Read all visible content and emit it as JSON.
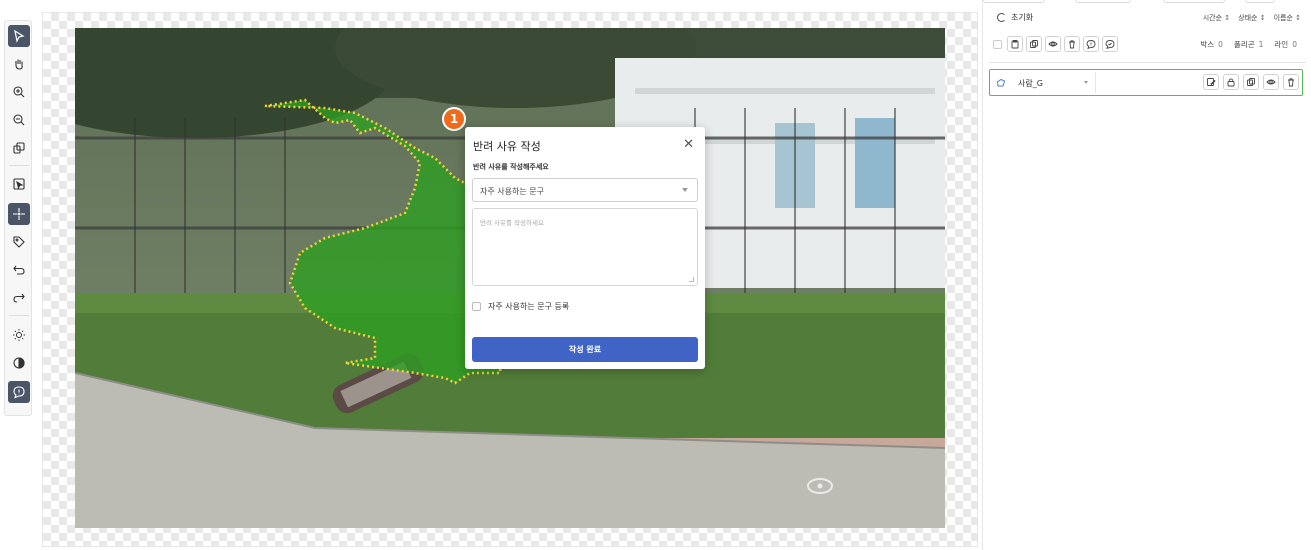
{
  "toolbar": {
    "tools": [
      {
        "name": "select-tool",
        "icon": "cursor-arrow-icon",
        "active": true
      },
      {
        "name": "pan-tool",
        "icon": "hand-icon"
      },
      {
        "name": "zoom-in-tool",
        "icon": "zoom-in-icon"
      },
      {
        "name": "zoom-out-tool",
        "icon": "zoom-out-icon"
      },
      {
        "name": "copy-layer-tool",
        "icon": "layers-icon"
      },
      {
        "name": "box-select-tool",
        "icon": "box-cursor-icon"
      },
      {
        "name": "point-tool",
        "icon": "crosshair-icon",
        "active": true
      },
      {
        "name": "tag-tool",
        "icon": "tag-icon"
      },
      {
        "name": "undo-tool",
        "icon": "undo-icon"
      },
      {
        "name": "redo-tool",
        "icon": "redo-icon"
      },
      {
        "name": "brightness-tool",
        "icon": "sun-icon"
      },
      {
        "name": "contrast-tool",
        "icon": "contrast-icon"
      },
      {
        "name": "comment-tool",
        "icon": "comment-icon",
        "active": true
      }
    ]
  },
  "canvas": {
    "annotation_number": "1",
    "annotation_color": "#ef6c1e",
    "polygon_color": "#2e9e22",
    "point_color": "#f5d23a"
  },
  "modal": {
    "title": "반려 사유 작성",
    "field_label": "반려 사유를 작성해주세요",
    "select_value": "자주 사용하는 문구",
    "textarea_placeholder": "반려 사유를 작성하세요",
    "checkbox_label": "자주 사용하는 문구 등록",
    "submit_label": "작성 완료",
    "submit_color": "#3f64c6"
  },
  "panel": {
    "reset_label": "초기화",
    "sorts": [
      "시간순",
      "상태순",
      "이름순"
    ],
    "counts": [
      {
        "label": "박스",
        "value": "0"
      },
      {
        "label": "폴리곤",
        "value": "1"
      },
      {
        "label": "라인",
        "value": "0"
      }
    ],
    "label_item": {
      "name": "사람_G",
      "color": "#5cb85c"
    }
  }
}
